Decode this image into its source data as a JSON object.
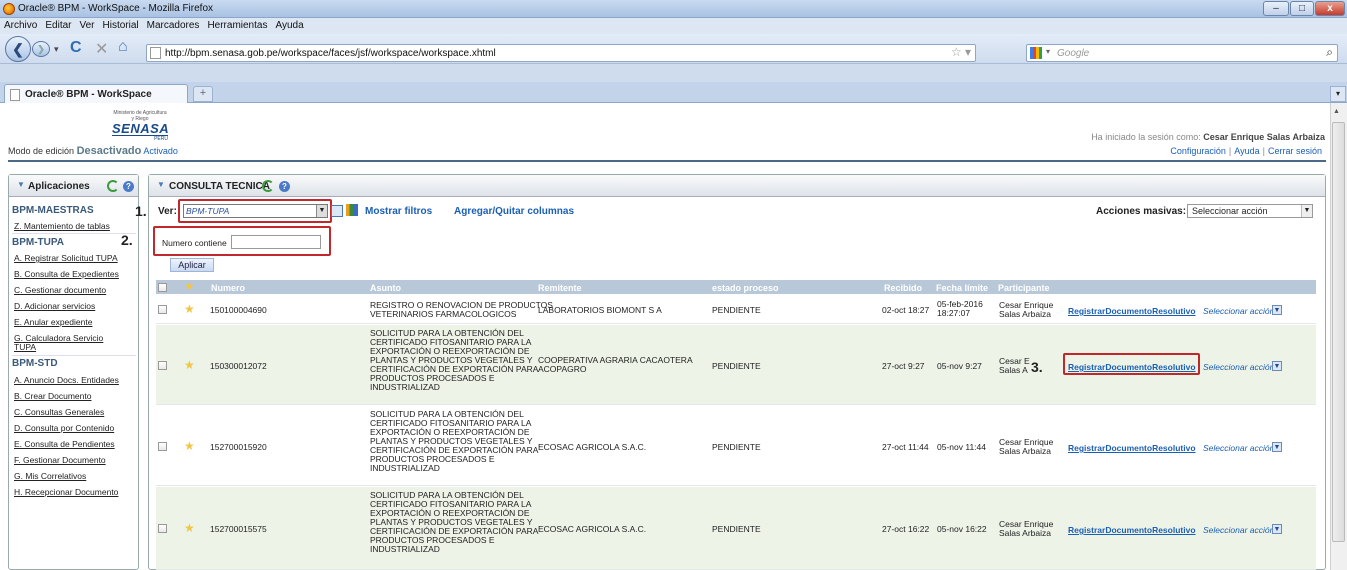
{
  "window": {
    "title": "Oracle® BPM - WorkSpace - Mozilla Firefox"
  },
  "menu": [
    "Archivo",
    "Editar",
    "Ver",
    "Historial",
    "Marcadores",
    "Herramientas",
    "Ayuda"
  ],
  "browser": {
    "url": "http://bpm.senasa.gob.pe/workspace/faces/jsf/workspace/workspace.xhtml",
    "search_placeholder": "Google",
    "tab_title": "Oracle® BPM - WorkSpace",
    "newtab": "+"
  },
  "logo": {
    "line1": "Ministerio de Agricultura y Riego",
    "brand": "SENASA",
    "country": "PERU"
  },
  "header": {
    "modo_label": "Modo de edición",
    "desactivado": "Desactivado",
    "activado": "Activado",
    "session_text": "Ha iniciado la sesión como:",
    "user": "Cesar Enrique Salas Arbaiza",
    "links": [
      "Configuración",
      "Ayuda",
      "Cerrar sesión"
    ]
  },
  "sidebar": {
    "title": "Aplicaciones",
    "sections": [
      {
        "title": "BPM-MAESTRAS",
        "items": [
          "Z. Mantemiento de tablas"
        ]
      },
      {
        "title": "BPM-TUPA",
        "items": [
          "A. Registrar Solicitud TUPA",
          "B. Consulta de Expedientes",
          "C. Gestionar documento",
          "D. Adicionar servicios",
          "E. Anular expediente",
          "G. Calculadora Servicio TUPA"
        ]
      },
      {
        "title": "BPM-STD",
        "items": [
          "A. Anuncio Docs. Entidades",
          "B. Crear Documento",
          "C. Consultas Generales",
          "D. Consulta por Contenido",
          "E. Consulta de Pendientes",
          "F. Gestionar Documento",
          "G. Mis Correlativos",
          "H. Recepcionar Documento"
        ]
      }
    ]
  },
  "main": {
    "title": "CONSULTA TECNICA",
    "ver_label": "Ver:",
    "ver_value": "BPM-TUPA",
    "mostrar_filtros": "Mostrar filtros",
    "agregar_columnas": "Agregar/Quitar columnas",
    "acciones_label": "Acciones masivas:",
    "acciones_value": "Seleccionar acción",
    "filter_label": "Numero contiene",
    "filter_value": "",
    "aplicar": "Aplicar",
    "annotations": [
      "1.",
      "2.",
      "3."
    ],
    "columns": [
      "Numero",
      "Asunto",
      "Remitente",
      "estado proceso",
      "Recibido",
      "Fecha límite",
      "Participante"
    ],
    "rows": [
      {
        "numero": "150100004690",
        "asunto": [
          "REGISTRO O RENOVACION DE PRODUCTOS",
          "VETERINARIOS FARMACOLOGICOS"
        ],
        "remitente": [
          "LABORATORIOS BIOMONT S A"
        ],
        "estado": "PENDIENTE",
        "recibido": "02-oct 18:27",
        "fecha_limite": [
          "05-feb-2016",
          "18:27:07"
        ],
        "participante": [
          "Cesar Enrique",
          "Salas Arbaiza"
        ],
        "accion": "RegistrarDocumentoResolutivo",
        "seleccionar": "Seleccionar acción"
      },
      {
        "numero": "150300012072",
        "asunto": [
          "SOLICITUD PARA LA OBTENCIÓN DEL",
          "CERTIFICADO FITOSANITARIO PARA LA",
          "EXPORTACIÓN O REEXPORTACIÓN DE",
          "PLANTAS Y PRODUCTOS VEGETALES Y",
          "CERTIFICACIÓN DE EXPORTACIÓN PARA",
          "PRODUCTOS PROCESADOS E",
          "INDUSTRIALIZAD"
        ],
        "remitente": [
          "COOPERATIVA AGRARIA CACAOTERA",
          "ACOPAGRO"
        ],
        "estado": "PENDIENTE",
        "recibido": "27-oct 9:27",
        "fecha_limite": [
          "05-nov 9:27"
        ],
        "participante": [
          "Cesar E",
          "Salas A"
        ],
        "accion": "RegistrarDocumentoResolutivo",
        "seleccionar": "Seleccionar acción"
      },
      {
        "numero": "152700015920",
        "asunto": [
          "SOLICITUD PARA LA OBTENCIÓN DEL",
          "CERTIFICADO FITOSANITARIO PARA LA",
          "EXPORTACIÓN O REEXPORTACIÓN DE",
          "PLANTAS Y PRODUCTOS VEGETALES Y",
          "CERTIFICACIÓN DE EXPORTACIÓN PARA",
          "PRODUCTOS PROCESADOS E",
          "INDUSTRIALIZAD"
        ],
        "remitente": [
          "ECOSAC AGRICOLA S.A.C."
        ],
        "estado": "PENDIENTE",
        "recibido": "27-oct 11:44",
        "fecha_limite": [
          "05-nov 11:44"
        ],
        "participante": [
          "Cesar Enrique",
          "Salas Arbaiza"
        ],
        "accion": "RegistrarDocumentoResolutivo",
        "seleccionar": "Seleccionar acción"
      },
      {
        "numero": "152700015575",
        "asunto": [
          "SOLICITUD PARA LA OBTENCIÓN DEL",
          "CERTIFICADO FITOSANITARIO PARA LA",
          "EXPORTACIÓN O REEXPORTACIÓN DE",
          "PLANTAS Y PRODUCTOS VEGETALES Y",
          "CERTIFICACIÓN DE EXPORTACIÓN PARA",
          "PRODUCTOS PROCESADOS E",
          "INDUSTRIALIZAD"
        ],
        "remitente": [
          "ECOSAC AGRICOLA S.A.C."
        ],
        "estado": "PENDIENTE",
        "recibido": "27-oct 16:22",
        "fecha_limite": [
          "05-nov 16:22"
        ],
        "participante": [
          "Cesar Enrique",
          "Salas Arbaiza"
        ],
        "accion": "RegistrarDocumentoResolutivo",
        "seleccionar": "Seleccionar acción"
      }
    ]
  },
  "colors": {
    "link": "#1a5fb4",
    "annotation": "#c0282c",
    "header_row": "#b8c8d8",
    "row_alt": "#eef3e8"
  }
}
